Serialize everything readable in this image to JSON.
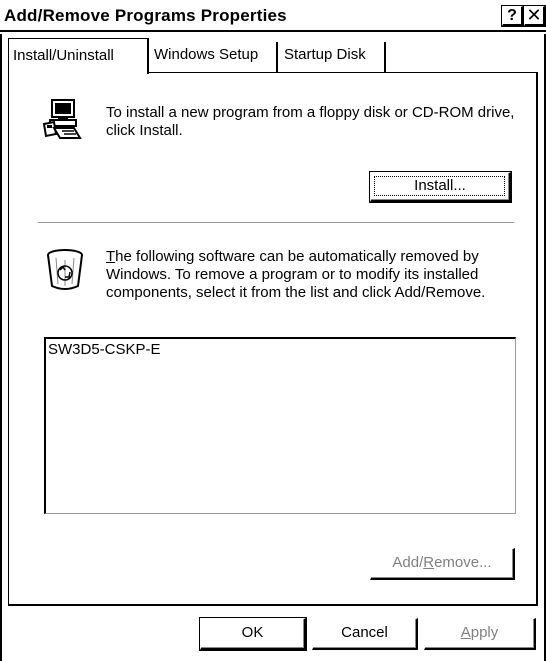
{
  "window": {
    "title": "Add/Remove Programs Properties",
    "help_label": "?",
    "close_label": "✕"
  },
  "tabs": [
    {
      "label": "Install/Uninstall",
      "active": true
    },
    {
      "label": "Windows Setup",
      "active": false
    },
    {
      "label": "Startup Disk",
      "active": false
    }
  ],
  "install": {
    "description": "To install a new program from a floppy disk or CD-ROM drive, click Install.",
    "button_label": "Install...",
    "icon": "computer-with-disk-icon"
  },
  "remove": {
    "description_accesskey": "T",
    "description_rest": "he following software can be automatically removed by Windows. To remove a program or to modify its installed components, select it from the list and click Add/Remove.",
    "icon": "recycle-bin-icon",
    "list_items": [
      "SW3D5-CSKP-E"
    ],
    "button_prefix": "Add/",
    "button_accesskey": "R",
    "button_suffix": "emove..."
  },
  "footer": {
    "ok_label": "OK",
    "cancel_label": "Cancel",
    "apply_accesskey": "A",
    "apply_rest": "pply"
  }
}
